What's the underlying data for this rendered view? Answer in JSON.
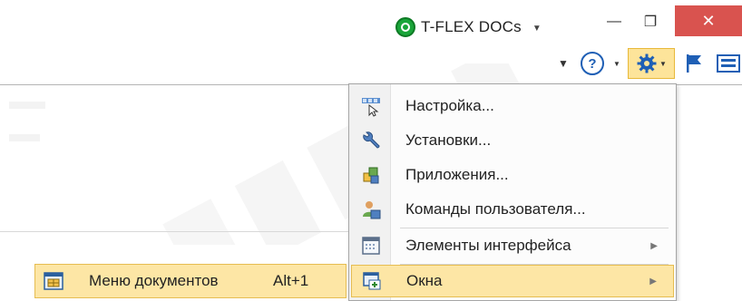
{
  "titlebar": {
    "app_name": "T-FLEX DOCs",
    "app_caret": "▼",
    "minimize": "—",
    "maximize": "❐",
    "close": "✕",
    "close_color": "#d9534f"
  },
  "toolbar": {
    "customize_caret": "▼",
    "help_symbol": "?",
    "help_caret": "▼",
    "gear_caret": "▼",
    "accent_color": "#fde49a"
  },
  "menu": {
    "items": [
      {
        "label": "Настройка...",
        "icon": "toolbar-customize-icon"
      },
      {
        "label": "Установки...",
        "icon": "wrench-icon"
      },
      {
        "label": "Приложения...",
        "icon": "applications-icon"
      },
      {
        "label": "Команды пользователя...",
        "icon": "user-commands-icon"
      },
      {
        "label": "Элементы интерфейса",
        "icon": "interface-elements-icon",
        "submenu": true
      },
      {
        "label": "Окна",
        "icon": "windows-icon",
        "submenu": true,
        "highlighted": true
      }
    ],
    "submenu_arrow": "▶",
    "highlight_color": "#fde6a5"
  },
  "left_item": {
    "label": "Меню документов",
    "shortcut": "Alt+1",
    "icon": "documents-menu-icon"
  }
}
